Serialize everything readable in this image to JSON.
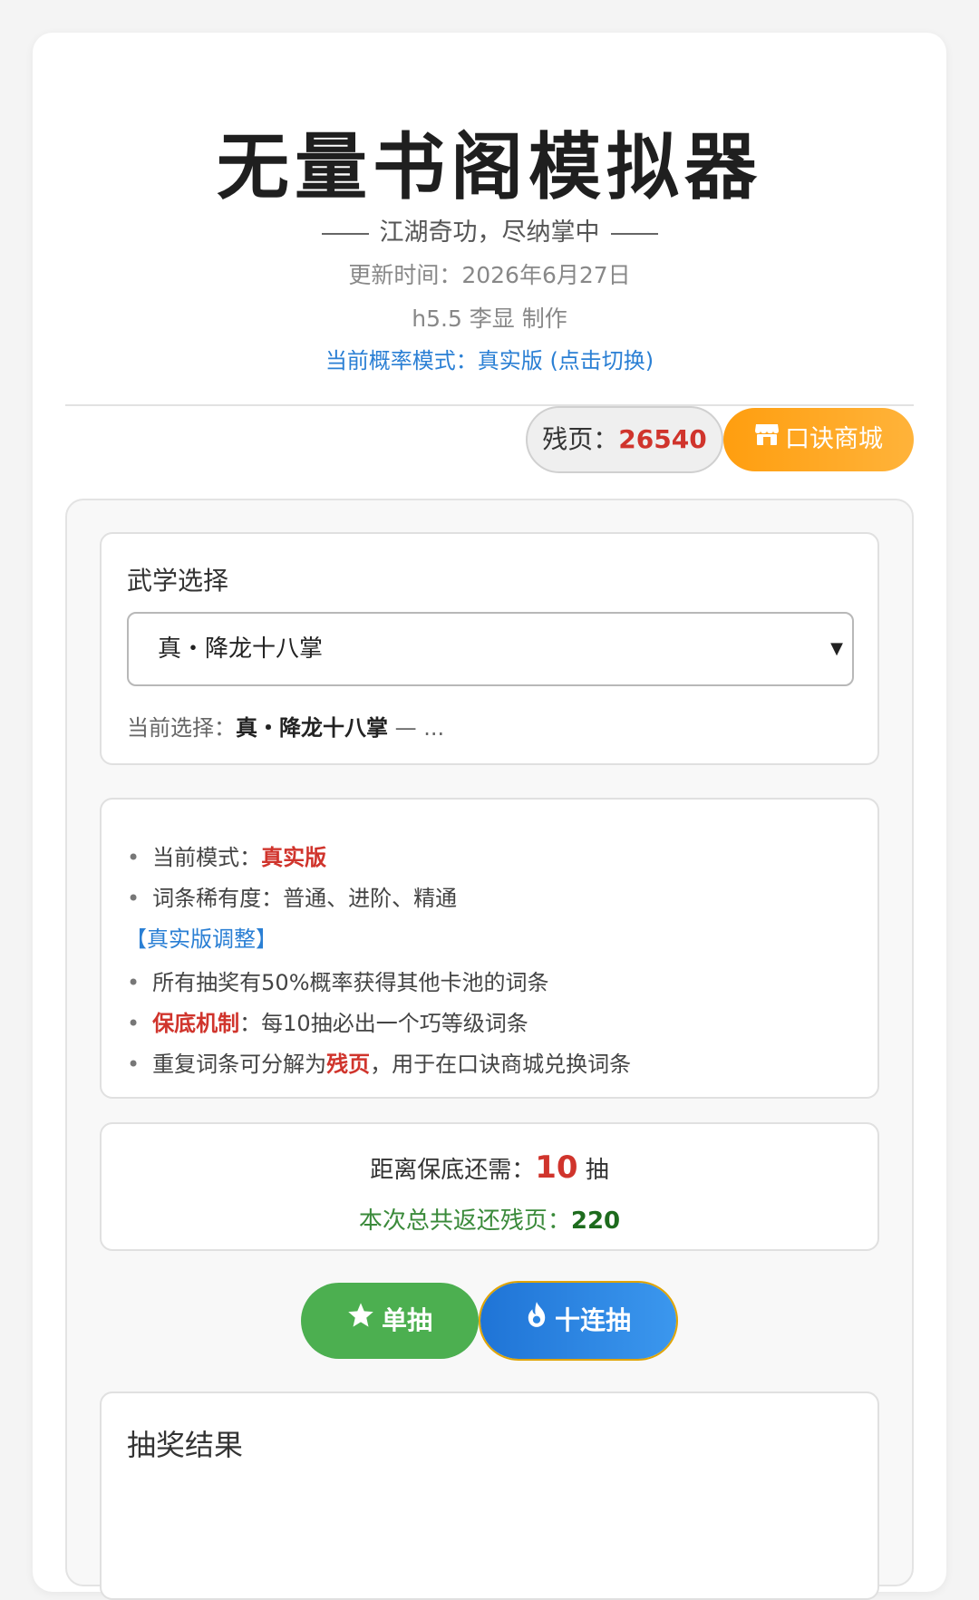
{
  "header": {
    "title": "无量书阁模拟器",
    "subtitle": "江湖奇功，尽纳掌中",
    "update_time": "更新时间：2026年6月27日",
    "author": "h5.5 李显 制作",
    "mode_toggle": "当前概率模式：真实版 (点击切换)"
  },
  "toolbar": {
    "fragments_label": "残页：",
    "fragments_value": "26540",
    "shop_label": "口诀商城"
  },
  "martial": {
    "label": "武学选择",
    "selected": "真・降龙十八掌",
    "current_label": "当前选择：",
    "current_value": "真・降龙十八掌",
    "current_suffix": " — ..."
  },
  "info": {
    "mode_label": "当前模式：",
    "mode_value": "真实版",
    "rarity": "词条稀有度：普通、进阶、精通",
    "adjust_title": "【真实版调整】",
    "rule1": "所有抽奖有50%概率获得其他卡池的词条",
    "rule2_bold": "保底机制",
    "rule2_rest": "：每10抽必出一个巧等级词条",
    "rule3_pre": "重复词条可分解为",
    "rule3_bold": "残页",
    "rule3_post": "，用于在口诀商城兑换词条"
  },
  "pity": {
    "label": "距离保底还需：",
    "count": "10",
    "unit": " 抽",
    "refund_label": "本次总共返还残页：",
    "refund_value": "220"
  },
  "actions": {
    "single_label": "单抽",
    "ten_label": "十连抽"
  },
  "results": {
    "label": "抽奖结果"
  },
  "colors": {
    "accent_blue": "#2a7fd4",
    "accent_red": "#d0342c",
    "shop_orange": "#ff9e0f",
    "single_green": "#4caf50"
  }
}
